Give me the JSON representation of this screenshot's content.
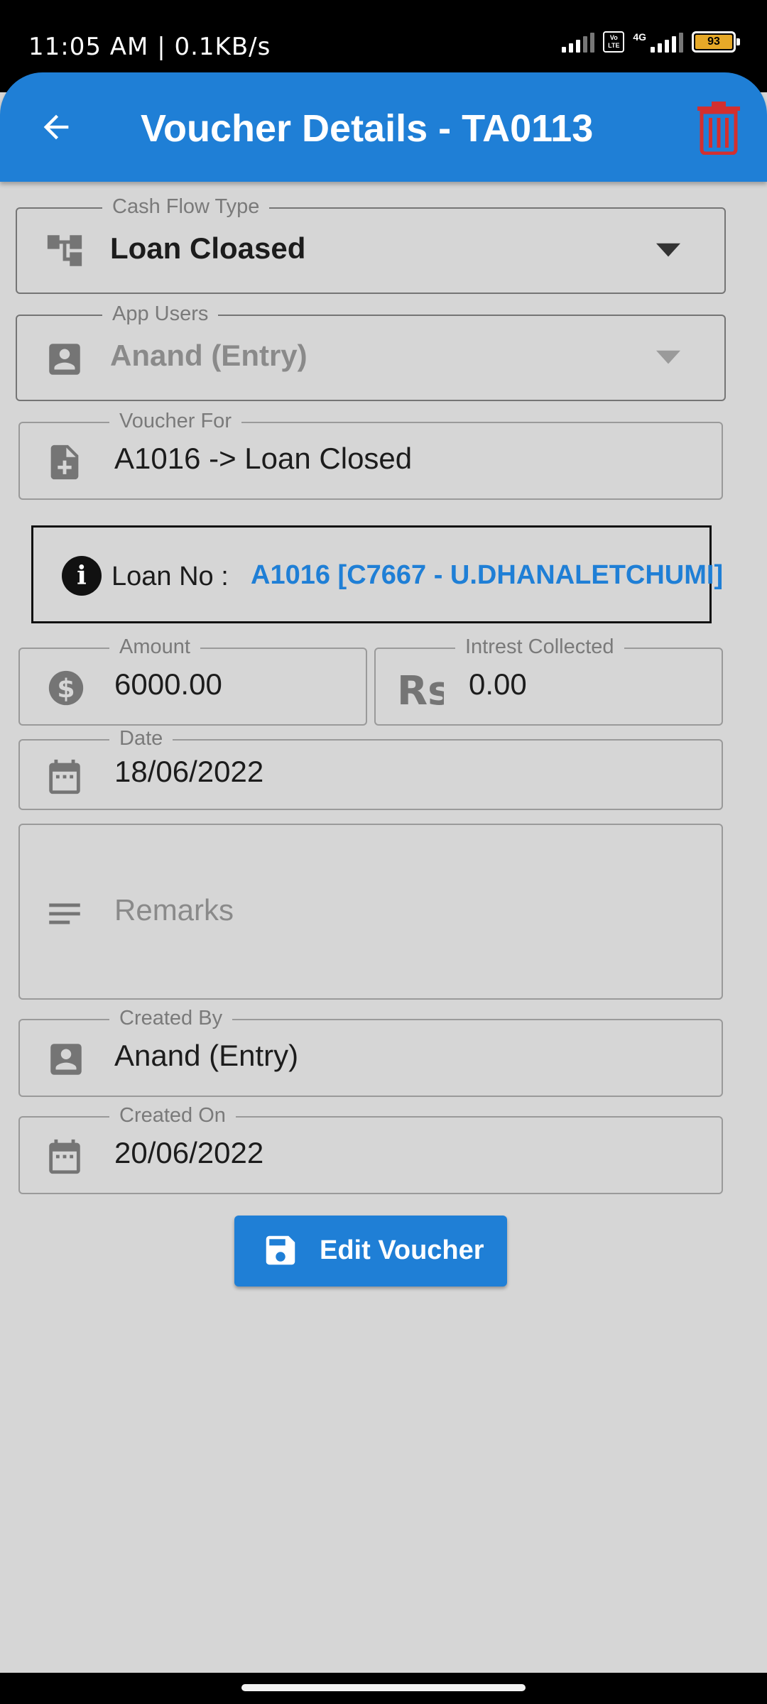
{
  "status_bar": {
    "time": "11:05 AM | 0.1KB/s",
    "network": "4G",
    "volte": "Vo LTE",
    "battery": "93",
    "battery_color": "#e6a928"
  },
  "app_bar": {
    "title": "Voucher Details - TA0113",
    "back_icon": "arrow-left-icon",
    "delete_icon": "trash-icon",
    "color": "#1f7fd6",
    "delete_color": "#d32f2f"
  },
  "form": {
    "cash_flow_type": {
      "label": "Cash Flow Type",
      "value": "Loan Cloased",
      "icon": "account-tree-icon"
    },
    "app_users": {
      "label": "App Users",
      "value": "Anand (Entry)",
      "icon": "person-box-icon"
    },
    "voucher_for": {
      "label": "Voucher For",
      "value": "A1016 -> Loan Closed",
      "icon": "note-add-icon"
    },
    "loan_info": {
      "label": "Loan No :",
      "value": "A1016 [C7667 - U.DHANALETCHUMI]",
      "icon": "info-icon"
    },
    "amount": {
      "label": "Amount",
      "value": "6000.00",
      "icon": "dollar-circle-icon"
    },
    "interest": {
      "label": "Intrest Collected",
      "value": "0.00",
      "icon": "rupee-icon"
    },
    "date": {
      "label": "Date",
      "value": "18/06/2022",
      "icon": "calendar-icon"
    },
    "remarks": {
      "placeholder": "Remarks",
      "icon": "notes-icon"
    },
    "created_by": {
      "label": "Created By",
      "value": "Anand (Entry)",
      "icon": "person-box-icon"
    },
    "created_on": {
      "label": "Created On",
      "value": "20/06/2022",
      "icon": "calendar-icon"
    }
  },
  "actions": {
    "edit_label": "Edit Voucher",
    "edit_icon": "save-icon"
  }
}
